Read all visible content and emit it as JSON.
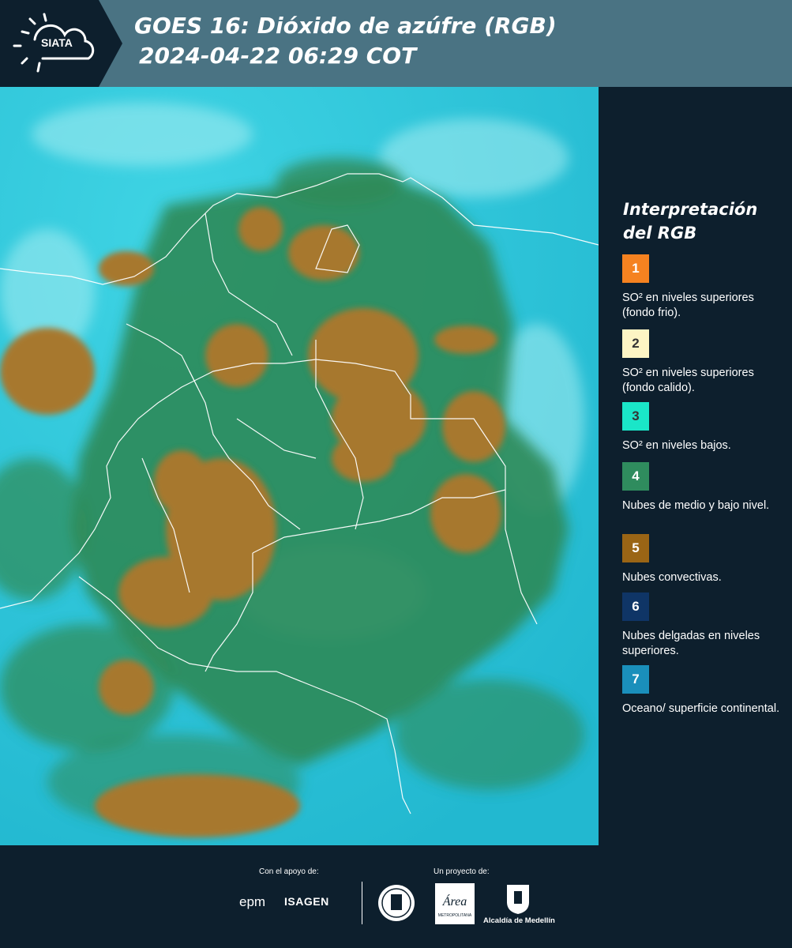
{
  "header": {
    "logo_text": "SIATA",
    "title_line1": "GOES 16: Dióxido de azúfre (RGB)",
    "title_line2": "2024-04-22 06:29 COT"
  },
  "legend": {
    "title": "Interpretación del RGB",
    "items": [
      {
        "number": "1",
        "color": "#f58220",
        "text": "SO² en niveles superiores (fondo frio)."
      },
      {
        "number": "2",
        "color": "#fdf5c4",
        "text": "SO² en niveles superiores (fondo calido)."
      },
      {
        "number": "3",
        "color": "#1ae6c8",
        "text": "SO² en niveles bajos."
      },
      {
        "number": "4",
        "color": "#2f8c5e",
        "text": "Nubes de medio y bajo nivel."
      },
      {
        "number": "5",
        "color": "#9a6515",
        "text": "Nubes convectivas."
      },
      {
        "number": "6",
        "color": "#0f3566",
        "text": "Nubes delgadas en niveles superiores."
      },
      {
        "number": "7",
        "color": "#1a8fbb",
        "text": "Oceano/ superficie continental."
      }
    ]
  },
  "footer": {
    "support_label": "Con el apoyo de:",
    "project_label": "Un proyecto de:",
    "sponsor_1": "epm",
    "sponsor_2": "ISAGEN",
    "partner_area": "Área Metropolitana Valle de Aburrá",
    "partner_alcaldia": "Alcaldía de Medellín"
  },
  "colors": {
    "header_bg": "#4a7383",
    "logo_bg": "#0d1f2d",
    "panel_bg": "#0d1f2d",
    "ocean": "#27c2d6",
    "convective": "#a7782d",
    "mid_low_clouds": "#2f8a56"
  }
}
